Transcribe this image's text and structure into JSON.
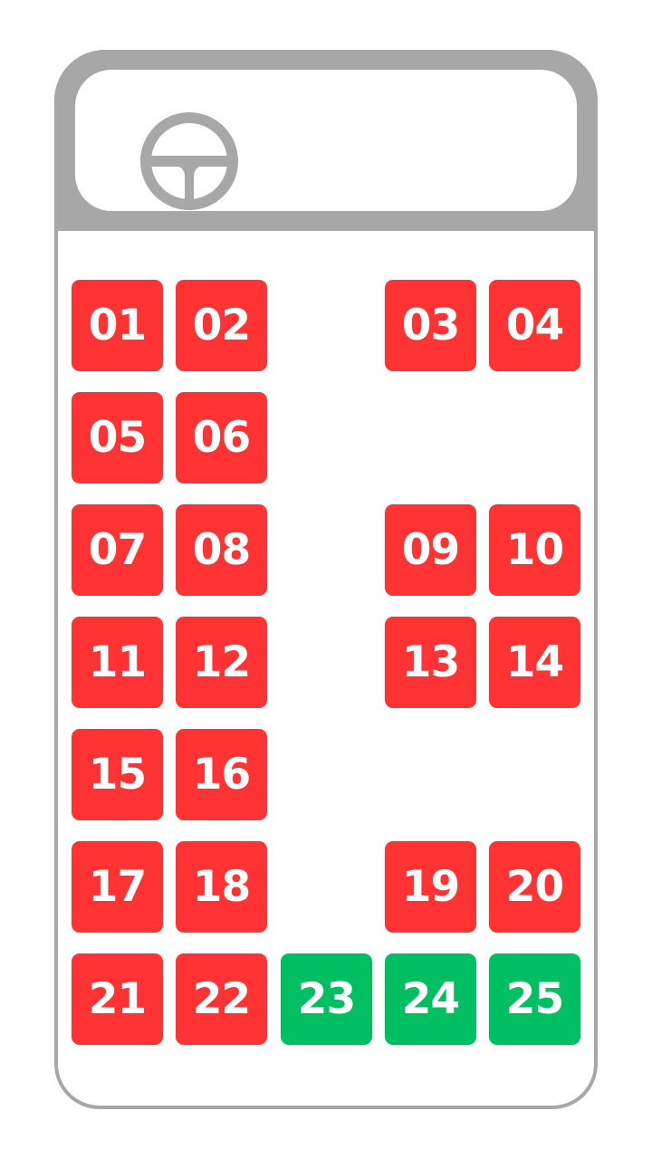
{
  "colors": {
    "taken": "#ff3333",
    "available": "#00bf63",
    "frame": "#a7a7a7"
  },
  "driver": {
    "icon": "steering-wheel-icon"
  },
  "seat_rows": [
    [
      {
        "label": "01",
        "status": "taken"
      },
      {
        "label": "02",
        "status": "taken"
      },
      null,
      {
        "label": "03",
        "status": "taken"
      },
      {
        "label": "04",
        "status": "taken"
      }
    ],
    [
      {
        "label": "05",
        "status": "taken"
      },
      {
        "label": "06",
        "status": "taken"
      },
      null,
      null,
      null
    ],
    [
      {
        "label": "07",
        "status": "taken"
      },
      {
        "label": "08",
        "status": "taken"
      },
      null,
      {
        "label": "09",
        "status": "taken"
      },
      {
        "label": "10",
        "status": "taken"
      }
    ],
    [
      {
        "label": "11",
        "status": "taken"
      },
      {
        "label": "12",
        "status": "taken"
      },
      null,
      {
        "label": "13",
        "status": "taken"
      },
      {
        "label": "14",
        "status": "taken"
      }
    ],
    [
      {
        "label": "15",
        "status": "taken"
      },
      {
        "label": "16",
        "status": "taken"
      },
      null,
      null,
      null
    ],
    [
      {
        "label": "17",
        "status": "taken"
      },
      {
        "label": "18",
        "status": "taken"
      },
      null,
      {
        "label": "19",
        "status": "taken"
      },
      {
        "label": "20",
        "status": "taken"
      }
    ],
    [
      {
        "label": "21",
        "status": "taken"
      },
      {
        "label": "22",
        "status": "taken"
      },
      {
        "label": "23",
        "status": "available"
      },
      {
        "label": "24",
        "status": "available"
      },
      {
        "label": "25",
        "status": "available"
      }
    ]
  ]
}
